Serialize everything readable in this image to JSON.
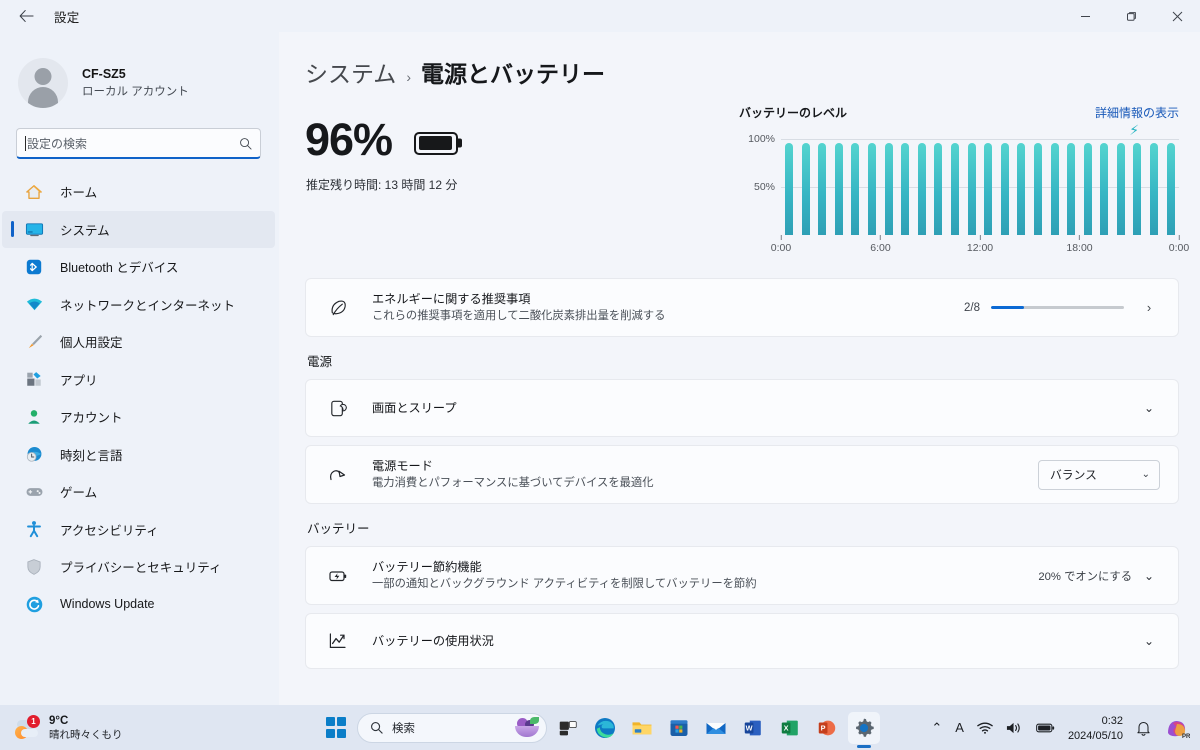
{
  "titlebar": {
    "back_label": "←",
    "app_title": "設定",
    "minimize": "—",
    "maximize": "❐",
    "close": "✕"
  },
  "sidebar": {
    "account": {
      "name": "CF-SZ5",
      "type": "ローカル アカウント"
    },
    "search": {
      "placeholder": "設定の検索",
      "icon": "search-icon"
    },
    "items": [
      {
        "label": "ホーム",
        "icon": "home-icon",
        "active": false
      },
      {
        "label": "システム",
        "icon": "system-display-icon",
        "active": true
      },
      {
        "label": "Bluetooth とデバイス",
        "icon": "bluetooth-icon",
        "active": false
      },
      {
        "label": "ネットワークとインターネット",
        "icon": "wifi-icon",
        "active": false
      },
      {
        "label": "個人用設定",
        "icon": "paintbrush-icon",
        "active": false
      },
      {
        "label": "アプリ",
        "icon": "apps-icon",
        "active": false
      },
      {
        "label": "アカウント",
        "icon": "account-person-icon",
        "active": false
      },
      {
        "label": "時刻と言語",
        "icon": "clock-globe-icon",
        "active": false
      },
      {
        "label": "ゲーム",
        "icon": "gamepad-icon",
        "active": false
      },
      {
        "label": "アクセシビリティ",
        "icon": "accessibility-icon",
        "active": false
      },
      {
        "label": "プライバシーとセキュリティ",
        "icon": "shield-icon",
        "active": false
      },
      {
        "label": "Windows Update",
        "icon": "update-refresh-icon",
        "active": false
      }
    ]
  },
  "main": {
    "breadcrumb": {
      "parent": "システム",
      "separator": "›",
      "current": "電源とバッテリー"
    },
    "battery_summary": {
      "percent": "96%",
      "estimate": "推定残り時間: 13 時間 12 分"
    },
    "chart_header": {
      "title": "バッテリーのレベル",
      "link": "詳細情報の表示",
      "charging_icon": "lightning-bolt-icon"
    },
    "energy_card": {
      "icon": "leaf-energy-icon",
      "title": "エネルギーに関する推奨事項",
      "subtitle": "これらの推奨事項を適用して二酸化炭素排出量を削減する",
      "fraction": "2/8",
      "progress_percent": 25,
      "chevron": "›"
    },
    "power_section": {
      "label": "電源",
      "rows": [
        {
          "icon": "screen-sleep-icon",
          "title": "画面とスリープ",
          "subtitle": "",
          "control": "chevron",
          "chevron": "⌄"
        },
        {
          "icon": "power-mode-icon",
          "title": "電源モード",
          "subtitle": "電力消費とパフォーマンスに基づいてデバイスを最適化",
          "control": "combo",
          "combo_value": "バランス",
          "combo_chevron": "⌄"
        }
      ]
    },
    "battery_section": {
      "label": "バッテリー",
      "rows": [
        {
          "icon": "battery-saver-icon",
          "title": "バッテリー節約機能",
          "subtitle": "一部の通知とバックグラウンド アクティビティを制限してバッテリーを節約",
          "value": "20% でオンにする",
          "chevron": "⌄"
        },
        {
          "icon": "usage-chart-icon",
          "title": "バッテリーの使用状況",
          "subtitle": "",
          "value": "",
          "chevron": "⌄"
        }
      ]
    }
  },
  "chart_data": {
    "type": "bar",
    "title": "バッテリーのレベル",
    "xlabel": "",
    "ylabel": "",
    "ylim": [
      0,
      100
    ],
    "ytick_labels": [
      "100%",
      "50%"
    ],
    "ytick_values": [
      100,
      50
    ],
    "xtick_labels": [
      "0:00",
      "6:00",
      "12:00",
      "18:00",
      "0:00"
    ],
    "xtick_values": [
      0,
      6,
      12,
      18,
      24
    ],
    "grid": true,
    "legend": false,
    "bar_color": "#37b6c4",
    "categories": [
      "0:00",
      "1:00",
      "2:00",
      "3:00",
      "4:00",
      "5:00",
      "6:00",
      "7:00",
      "8:00",
      "9:00",
      "10:00",
      "11:00",
      "12:00",
      "13:00",
      "14:00",
      "15:00",
      "16:00",
      "17:00",
      "18:00",
      "19:00",
      "20:00",
      "21:00",
      "22:00",
      "23:00"
    ],
    "values": [
      96,
      96,
      96,
      96,
      96,
      96,
      96,
      96,
      96,
      96,
      96,
      96,
      96,
      96,
      96,
      96,
      96,
      96,
      96,
      96,
      96,
      96,
      96,
      96
    ],
    "annotations": [
      {
        "text": "⚡",
        "x": 21,
        "y": 104,
        "meaning": "charging"
      }
    ]
  },
  "taskbar": {
    "weather": {
      "temperature": "9°C",
      "condition": "晴れ時々くもり",
      "badge": "1",
      "icon": "sun-cloud-icon"
    },
    "start": {
      "icon": "windows-start-icon"
    },
    "search": {
      "icon": "search-icon",
      "placeholder": "検索",
      "decor_icon": "fruit-bowl-icon"
    },
    "apps": [
      {
        "name": "task-view",
        "icon": "task-view-icon"
      },
      {
        "name": "edge",
        "icon": "edge-icon"
      },
      {
        "name": "file-explorer",
        "icon": "folder-icon"
      },
      {
        "name": "microsoft-store",
        "icon": "store-icon"
      },
      {
        "name": "mail",
        "icon": "mail-icon"
      },
      {
        "name": "word",
        "icon": "word-icon",
        "letter": "W"
      },
      {
        "name": "excel",
        "icon": "excel-icon",
        "letter": "X"
      },
      {
        "name": "powerpoint",
        "icon": "powerpoint-icon",
        "letter": "P"
      },
      {
        "name": "settings",
        "icon": "gear-icon",
        "active": true
      }
    ],
    "tray": {
      "overflow": "⌃",
      "ime": "A",
      "network": "wifi-icon",
      "volume": "speaker-icon",
      "battery": "battery-icon",
      "time": "0:32",
      "date": "2024/05/10",
      "notifications": "bell-icon",
      "copilot": "copilot-icon"
    }
  }
}
